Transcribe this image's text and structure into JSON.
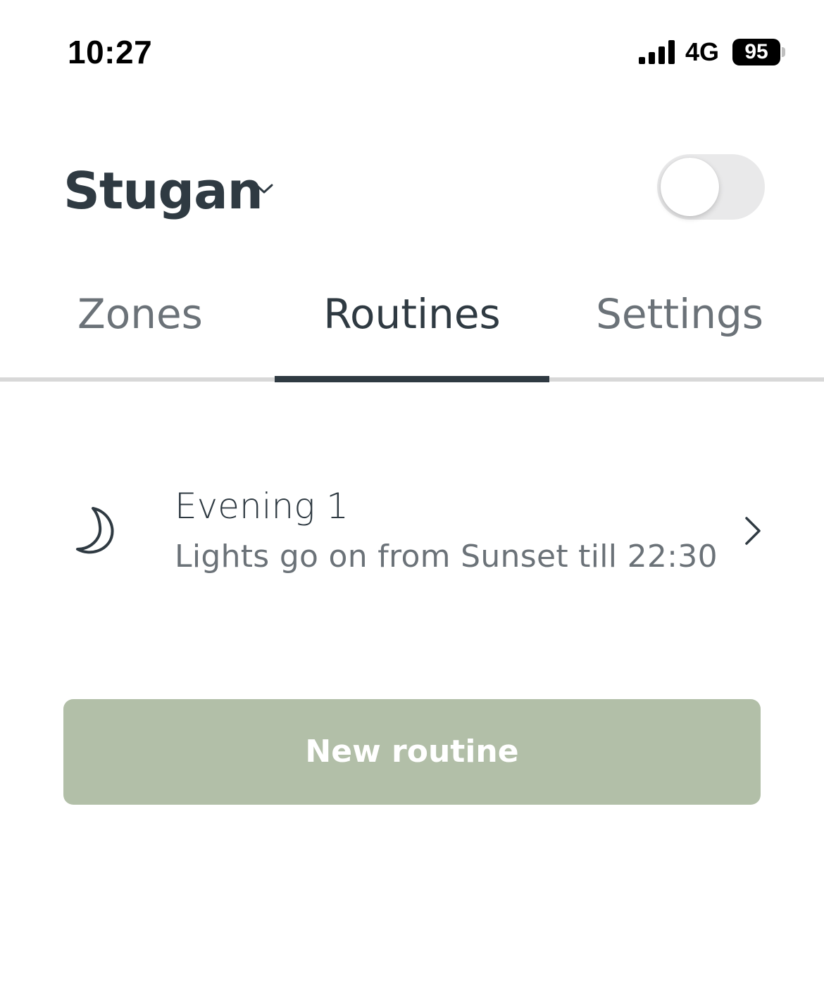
{
  "status_bar": {
    "time": "10:27",
    "network": "4G",
    "battery_percent": "95",
    "signal_bars": 4
  },
  "header": {
    "home_name": "Stugan",
    "dropdown_icon": "chevron-down-icon",
    "toggle_on": false
  },
  "tabs": [
    {
      "label": "Zones",
      "active": false
    },
    {
      "label": "Routines",
      "active": true
    },
    {
      "label": "Settings",
      "active": false
    }
  ],
  "routines": [
    {
      "icon": "moon-icon",
      "title": "Evening 1",
      "description": "Lights go on from Sunset till 22:30"
    }
  ],
  "actions": {
    "new_routine_label": "New routine"
  },
  "colors": {
    "text_primary": "#2f3a42",
    "text_secondary": "#6b7278",
    "button_bg": "#b2bfa8",
    "toggle_off_bg": "#e9e9ea",
    "tab_line": "#d8d8d8"
  }
}
